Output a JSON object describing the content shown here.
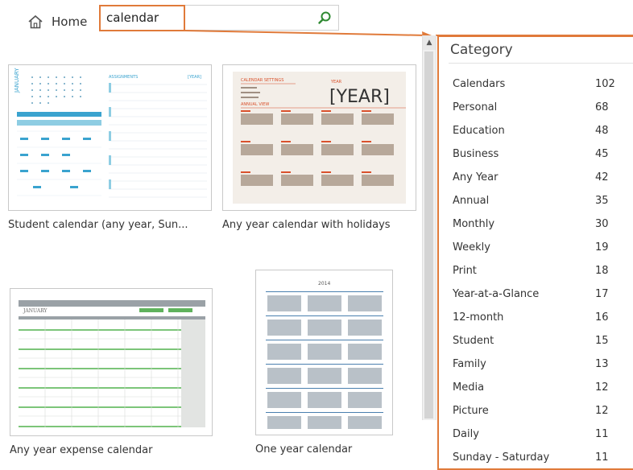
{
  "header": {
    "home_label": "Home",
    "search_value": "calendar"
  },
  "templates": [
    {
      "title": "Student calendar (any year, Sun..."
    },
    {
      "title": "Any year calendar with holidays",
      "thumb_text": "[YEAR]"
    },
    {
      "title": "Any year expense calendar",
      "thumb_text": "JANUARY"
    },
    {
      "title": "One year calendar",
      "thumb_text": "2014"
    }
  ],
  "category": {
    "title": "Category",
    "items": [
      {
        "label": "Calendars",
        "count": "102"
      },
      {
        "label": "Personal",
        "count": "68"
      },
      {
        "label": "Education",
        "count": "48"
      },
      {
        "label": "Business",
        "count": "45"
      },
      {
        "label": "Any Year",
        "count": "42"
      },
      {
        "label": "Annual",
        "count": "35"
      },
      {
        "label": "Monthly",
        "count": "30"
      },
      {
        "label": "Weekly",
        "count": "19"
      },
      {
        "label": "Print",
        "count": "18"
      },
      {
        "label": "Year-at-a-Glance",
        "count": "17"
      },
      {
        "label": "12-month",
        "count": "16"
      },
      {
        "label": "Student",
        "count": "15"
      },
      {
        "label": "Family",
        "count": "13"
      },
      {
        "label": "Media",
        "count": "12"
      },
      {
        "label": "Picture",
        "count": "12"
      },
      {
        "label": "Daily",
        "count": "11"
      },
      {
        "label": "Sunday - Saturday",
        "count": "11"
      }
    ]
  },
  "colors": {
    "highlight": "#e07a3a",
    "student_blue": "#3aa3cf",
    "holiday_accent": "#d9512c",
    "expense_green": "#5fb25c"
  },
  "icons": {
    "home": "home-icon",
    "search": "search-icon",
    "scroll_up": "scroll-up-arrow-icon"
  }
}
